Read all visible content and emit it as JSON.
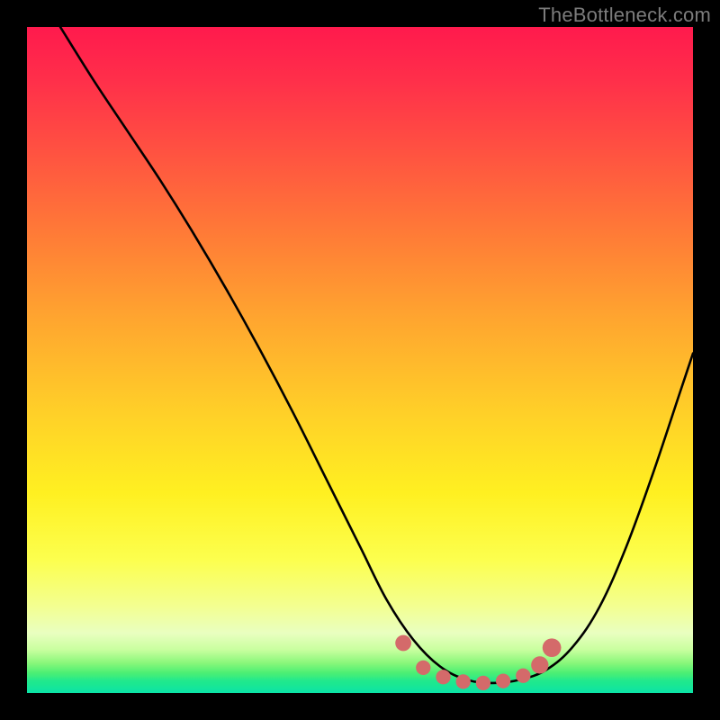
{
  "watermark": "TheBottleneck.com",
  "chart_data": {
    "type": "line",
    "title": "",
    "xlabel": "",
    "ylabel": "",
    "xlim": [
      0,
      100
    ],
    "ylim": [
      0,
      100
    ],
    "series": [
      {
        "name": "bottleneck-curve",
        "x": [
          5,
          10,
          15,
          20,
          25,
          30,
          35,
          40,
          45,
          50,
          54,
          58,
          62,
          66,
          70,
          74,
          78,
          82,
          86,
          90,
          94,
          98,
          100
        ],
        "y": [
          100,
          92,
          84.5,
          77,
          69,
          60.5,
          51.5,
          42,
          32,
          22,
          14,
          8,
          4,
          2,
          1.5,
          2,
          3.5,
          7,
          13,
          22,
          33,
          45,
          51
        ]
      }
    ],
    "markers": {
      "name": "bottom-cluster",
      "color": "#d46a6a",
      "points": [
        {
          "x": 56.5,
          "y": 7.5,
          "r": 1.2
        },
        {
          "x": 59.5,
          "y": 3.8,
          "r": 1.1
        },
        {
          "x": 62.5,
          "y": 2.4,
          "r": 1.1
        },
        {
          "x": 65.5,
          "y": 1.7,
          "r": 1.1
        },
        {
          "x": 68.5,
          "y": 1.5,
          "r": 1.1
        },
        {
          "x": 71.5,
          "y": 1.8,
          "r": 1.1
        },
        {
          "x": 74.5,
          "y": 2.6,
          "r": 1.1
        },
        {
          "x": 77.0,
          "y": 4.2,
          "r": 1.3
        },
        {
          "x": 78.8,
          "y": 6.8,
          "r": 1.4
        }
      ]
    },
    "gradient_stops": [
      {
        "pos": 0,
        "color": "#ff1a4d"
      },
      {
        "pos": 50,
        "color": "#ffc028"
      },
      {
        "pos": 80,
        "color": "#fcff4e"
      },
      {
        "pos": 100,
        "color": "#0be3a6"
      }
    ]
  }
}
